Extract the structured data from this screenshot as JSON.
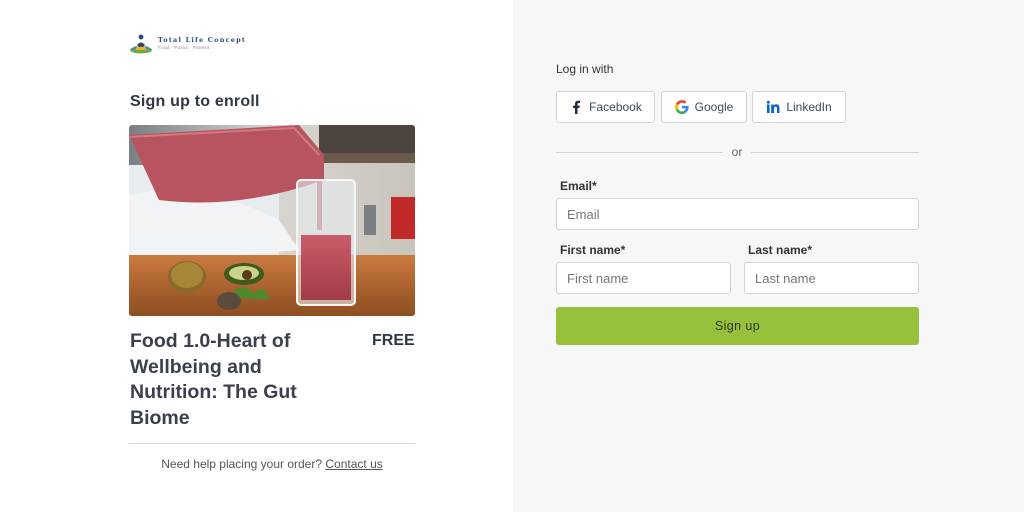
{
  "brand": {
    "name": "Total Life Concept",
    "tagline": "Food · Focus · Fitness"
  },
  "enroll": {
    "heading": "Sign up to enroll"
  },
  "product": {
    "image_alt": "smoothie-being-poured",
    "title": "Food 1.0-Heart of Wellbeing and Nutrition: The Gut Biome",
    "price": "FREE"
  },
  "help": {
    "text": "Need help placing your order?",
    "link_label": "Contact us"
  },
  "login": {
    "heading": "Log in with",
    "providers": [
      {
        "label": "Facebook",
        "icon": "facebook-icon",
        "color": "#3b5998"
      },
      {
        "label": "Google",
        "icon": "google-icon",
        "color": "#4285f4"
      },
      {
        "label": "LinkedIn",
        "icon": "linkedin-icon",
        "color": "#0a66c2"
      }
    ],
    "separator": "or"
  },
  "form": {
    "email_label": "Email*",
    "email_placeholder": "Email",
    "first_name_label": "First name*",
    "first_name_placeholder": "First name",
    "last_name_label": "Last name*",
    "last_name_placeholder": "Last name",
    "submit_label": "Sign up"
  },
  "colors": {
    "accent": "#97c13d",
    "border": "#cfd4da",
    "heading": "#2e3744"
  }
}
